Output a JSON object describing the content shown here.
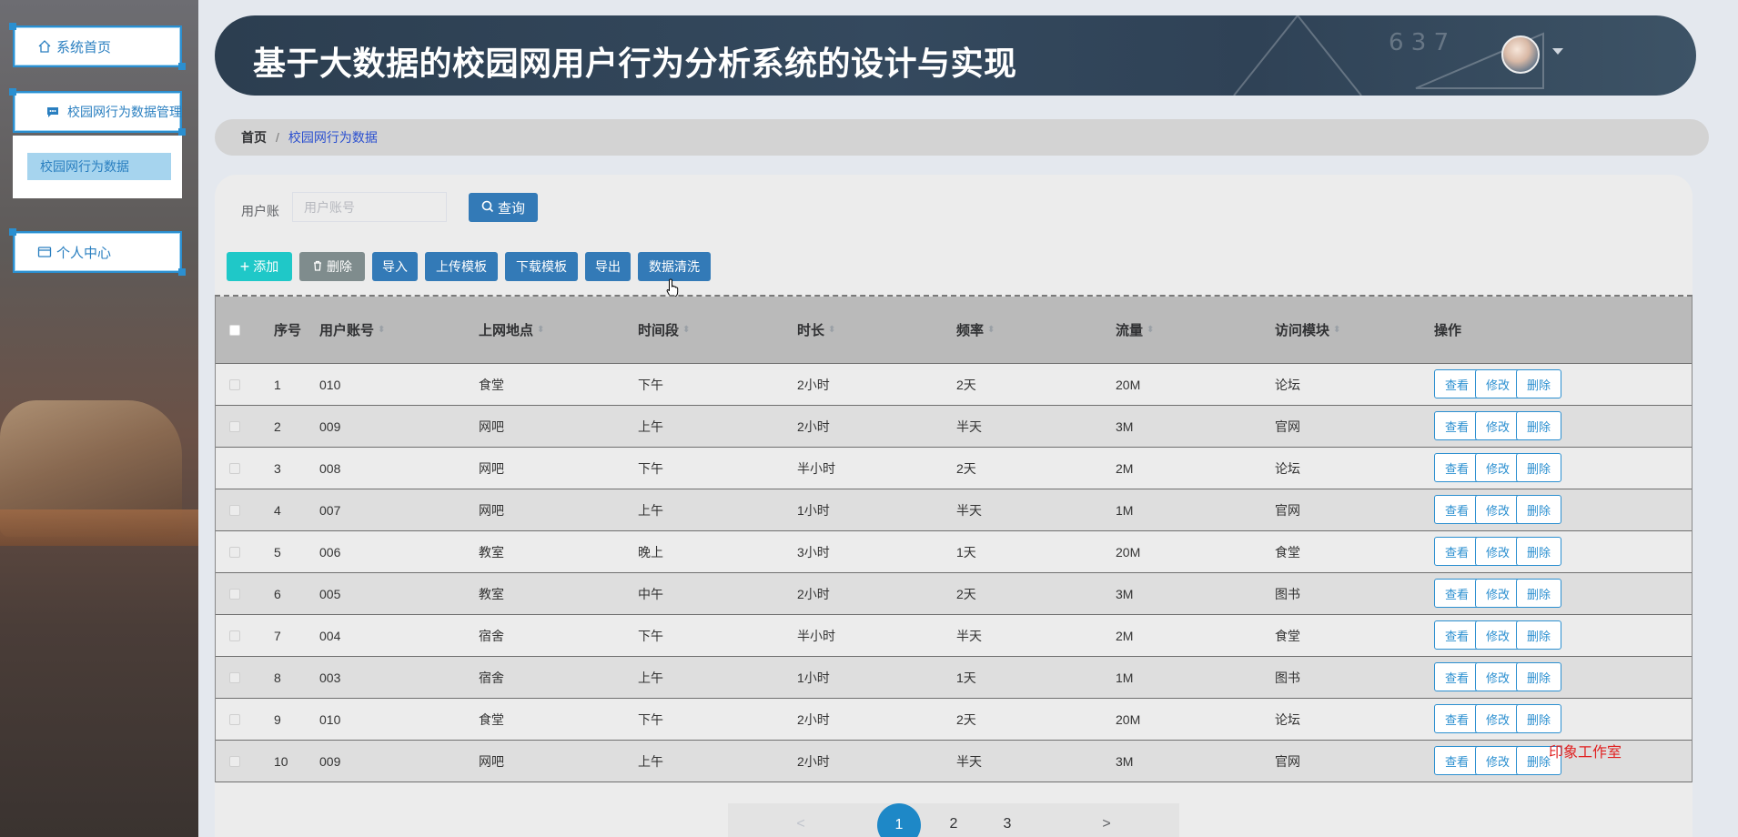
{
  "sidebar": {
    "home": "系统首页",
    "behavior_mgmt": "校园网行为数据管理",
    "behavior_data": "校园网行为数据",
    "personal": "个人中心"
  },
  "header": {
    "title": "基于大数据的校园网用户行为分析系统的设计与实现"
  },
  "breadcrumb": {
    "home": "首页",
    "separator": "/",
    "current": "校园网行为数据"
  },
  "search": {
    "label": "用户账",
    "placeholder": "用户账号",
    "button": "查询"
  },
  "toolbar": {
    "add": "添加",
    "delete": "删除",
    "import": "导入",
    "upload_template": "上传模板",
    "download_template": "下载模板",
    "export": "导出",
    "clean": "数据清洗"
  },
  "table": {
    "headers": [
      "序号",
      "用户账号",
      "上网地点",
      "时间段",
      "时长",
      "频率",
      "流量",
      "访问模块",
      "操作"
    ],
    "rows": [
      [
        "1",
        "010",
        "食堂",
        "下午",
        "2小时",
        "2天",
        "20M",
        "论坛"
      ],
      [
        "2",
        "009",
        "网吧",
        "上午",
        "2小时",
        "半天",
        "3M",
        "官网"
      ],
      [
        "3",
        "008",
        "网吧",
        "下午",
        "半小时",
        "2天",
        "2M",
        "论坛"
      ],
      [
        "4",
        "007",
        "网吧",
        "上午",
        "1小时",
        "半天",
        "1M",
        "官网"
      ],
      [
        "5",
        "006",
        "教室",
        "晚上",
        "3小时",
        "1天",
        "20M",
        "食堂"
      ],
      [
        "6",
        "005",
        "教室",
        "中午",
        "2小时",
        "2天",
        "3M",
        "图书"
      ],
      [
        "7",
        "004",
        "宿舍",
        "下午",
        "半小时",
        "半天",
        "2M",
        "食堂"
      ],
      [
        "8",
        "003",
        "宿舍",
        "上午",
        "1小时",
        "1天",
        "1M",
        "图书"
      ],
      [
        "9",
        "010",
        "食堂",
        "下午",
        "2小时",
        "2天",
        "20M",
        "论坛"
      ],
      [
        "10",
        "009",
        "网吧",
        "上午",
        "2小时",
        "半天",
        "3M",
        "官网"
      ]
    ],
    "actions": {
      "view": "查看",
      "edit": "修改",
      "delete": "删除"
    }
  },
  "watermark": "印象工作室",
  "pagination": {
    "prev": "<",
    "pages": [
      "1",
      "2",
      "3"
    ],
    "current": "1",
    "next": ">"
  },
  "colors": {
    "primary": "#337ab7",
    "add": "#1fc8c8",
    "delete": "#7f8c8d",
    "header_bg": "#2c3e50",
    "accent": "#2b8fd0"
  }
}
